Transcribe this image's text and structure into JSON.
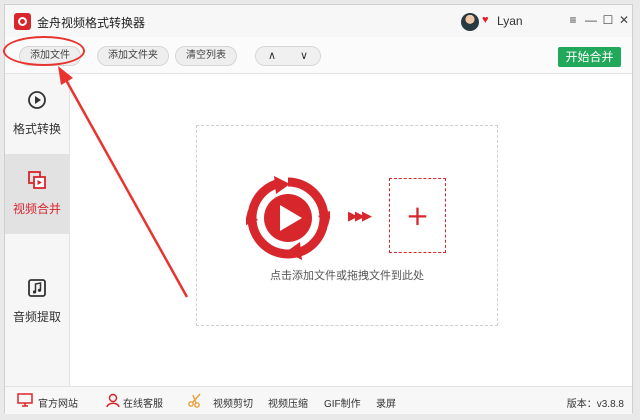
{
  "app": {
    "title": "金舟视频格式转换器",
    "username": "Lyan",
    "window_controls": {
      "menu": "≡",
      "minimize": "—",
      "maximize": "☐",
      "close": "✕"
    }
  },
  "toolbar": {
    "add_file": "添加文件",
    "add_folder": "添加文件夹",
    "clear_list": "清空列表",
    "move_up": "∧",
    "move_down": "∨",
    "start_merge": "开始合并"
  },
  "sidebar": {
    "items": [
      {
        "label": "格式转换",
        "icon": "play-circle-icon",
        "active": false
      },
      {
        "label": "视频合并",
        "icon": "merge-video-icon",
        "active": true
      },
      {
        "label": "音频提取",
        "icon": "music-note-icon",
        "active": false
      }
    ]
  },
  "main": {
    "drop_hint": "点击添加文件或拖拽文件到此处",
    "plus": "+",
    "chevrons": "▶▶▶"
  },
  "statusbar": {
    "official_site": "官方网站",
    "online_support": "在线客服",
    "video_cut": "视频剪切",
    "video_compress": "视频压缩",
    "gif_make": "GIF制作",
    "screen_record": "录屏",
    "version": "版本：v3.8.8"
  },
  "colors": {
    "accent_red": "#d8262d",
    "merge_green": "#22a85a",
    "annotation_red": "#e8332e"
  }
}
